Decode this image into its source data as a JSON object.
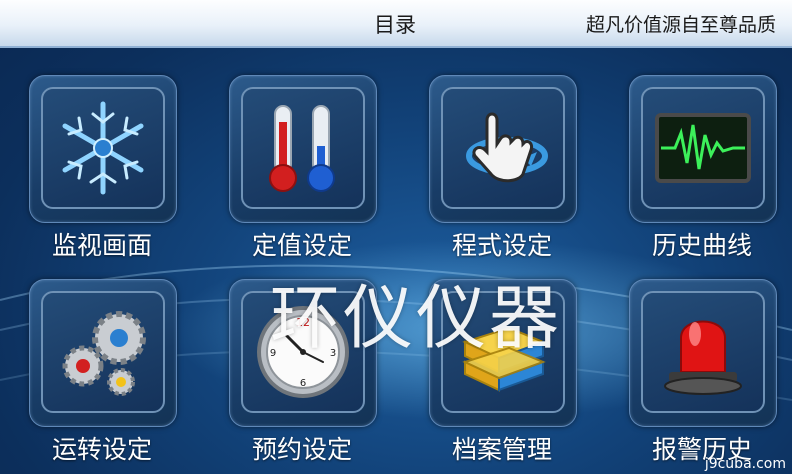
{
  "header": {
    "title": "目录",
    "slogan": "超凡价值源自至尊品质"
  },
  "menu": [
    {
      "label": "监视画面",
      "icon": "snowflake-icon"
    },
    {
      "label": "定值设定",
      "icon": "thermometer-icon"
    },
    {
      "label": "程式设定",
      "icon": "hand-pointer-icon"
    },
    {
      "label": "历史曲线",
      "icon": "waveform-monitor-icon"
    },
    {
      "label": "运转设定",
      "icon": "gears-icon"
    },
    {
      "label": "预约设定",
      "icon": "clock-icon"
    },
    {
      "label": "档案管理",
      "icon": "books-icon"
    },
    {
      "label": "报警历史",
      "icon": "alarm-siren-icon"
    }
  ],
  "watermark": "环仪仪器",
  "corner_text": "j9cuba.com"
}
